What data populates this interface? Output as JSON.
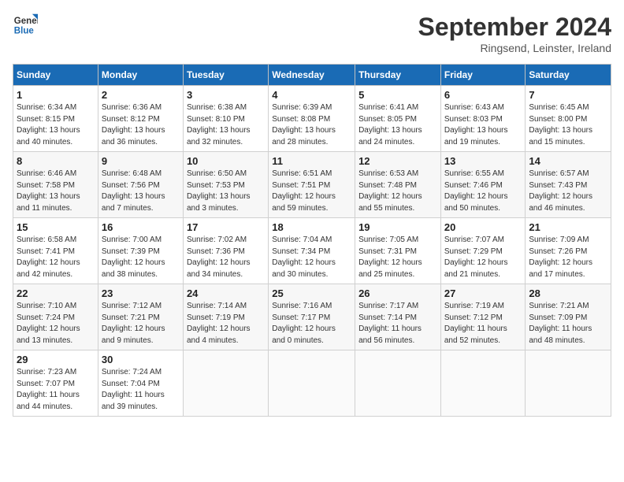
{
  "header": {
    "logo_line1": "General",
    "logo_line2": "Blue",
    "month": "September 2024",
    "location": "Ringsend, Leinster, Ireland"
  },
  "columns": [
    "Sunday",
    "Monday",
    "Tuesday",
    "Wednesday",
    "Thursday",
    "Friday",
    "Saturday"
  ],
  "weeks": [
    [
      {
        "day": "1",
        "lines": [
          "Sunrise: 6:34 AM",
          "Sunset: 8:15 PM",
          "Daylight: 13 hours",
          "and 40 minutes."
        ]
      },
      {
        "day": "2",
        "lines": [
          "Sunrise: 6:36 AM",
          "Sunset: 8:12 PM",
          "Daylight: 13 hours",
          "and 36 minutes."
        ]
      },
      {
        "day": "3",
        "lines": [
          "Sunrise: 6:38 AM",
          "Sunset: 8:10 PM",
          "Daylight: 13 hours",
          "and 32 minutes."
        ]
      },
      {
        "day": "4",
        "lines": [
          "Sunrise: 6:39 AM",
          "Sunset: 8:08 PM",
          "Daylight: 13 hours",
          "and 28 minutes."
        ]
      },
      {
        "day": "5",
        "lines": [
          "Sunrise: 6:41 AM",
          "Sunset: 8:05 PM",
          "Daylight: 13 hours",
          "and 24 minutes."
        ]
      },
      {
        "day": "6",
        "lines": [
          "Sunrise: 6:43 AM",
          "Sunset: 8:03 PM",
          "Daylight: 13 hours",
          "and 19 minutes."
        ]
      },
      {
        "day": "7",
        "lines": [
          "Sunrise: 6:45 AM",
          "Sunset: 8:00 PM",
          "Daylight: 13 hours",
          "and 15 minutes."
        ]
      }
    ],
    [
      {
        "day": "8",
        "lines": [
          "Sunrise: 6:46 AM",
          "Sunset: 7:58 PM",
          "Daylight: 13 hours",
          "and 11 minutes."
        ]
      },
      {
        "day": "9",
        "lines": [
          "Sunrise: 6:48 AM",
          "Sunset: 7:56 PM",
          "Daylight: 13 hours",
          "and 7 minutes."
        ]
      },
      {
        "day": "10",
        "lines": [
          "Sunrise: 6:50 AM",
          "Sunset: 7:53 PM",
          "Daylight: 13 hours",
          "and 3 minutes."
        ]
      },
      {
        "day": "11",
        "lines": [
          "Sunrise: 6:51 AM",
          "Sunset: 7:51 PM",
          "Daylight: 12 hours",
          "and 59 minutes."
        ]
      },
      {
        "day": "12",
        "lines": [
          "Sunrise: 6:53 AM",
          "Sunset: 7:48 PM",
          "Daylight: 12 hours",
          "and 55 minutes."
        ]
      },
      {
        "day": "13",
        "lines": [
          "Sunrise: 6:55 AM",
          "Sunset: 7:46 PM",
          "Daylight: 12 hours",
          "and 50 minutes."
        ]
      },
      {
        "day": "14",
        "lines": [
          "Sunrise: 6:57 AM",
          "Sunset: 7:43 PM",
          "Daylight: 12 hours",
          "and 46 minutes."
        ]
      }
    ],
    [
      {
        "day": "15",
        "lines": [
          "Sunrise: 6:58 AM",
          "Sunset: 7:41 PM",
          "Daylight: 12 hours",
          "and 42 minutes."
        ]
      },
      {
        "day": "16",
        "lines": [
          "Sunrise: 7:00 AM",
          "Sunset: 7:39 PM",
          "Daylight: 12 hours",
          "and 38 minutes."
        ]
      },
      {
        "day": "17",
        "lines": [
          "Sunrise: 7:02 AM",
          "Sunset: 7:36 PM",
          "Daylight: 12 hours",
          "and 34 minutes."
        ]
      },
      {
        "day": "18",
        "lines": [
          "Sunrise: 7:04 AM",
          "Sunset: 7:34 PM",
          "Daylight: 12 hours",
          "and 30 minutes."
        ]
      },
      {
        "day": "19",
        "lines": [
          "Sunrise: 7:05 AM",
          "Sunset: 7:31 PM",
          "Daylight: 12 hours",
          "and 25 minutes."
        ]
      },
      {
        "day": "20",
        "lines": [
          "Sunrise: 7:07 AM",
          "Sunset: 7:29 PM",
          "Daylight: 12 hours",
          "and 21 minutes."
        ]
      },
      {
        "day": "21",
        "lines": [
          "Sunrise: 7:09 AM",
          "Sunset: 7:26 PM",
          "Daylight: 12 hours",
          "and 17 minutes."
        ]
      }
    ],
    [
      {
        "day": "22",
        "lines": [
          "Sunrise: 7:10 AM",
          "Sunset: 7:24 PM",
          "Daylight: 12 hours",
          "and 13 minutes."
        ]
      },
      {
        "day": "23",
        "lines": [
          "Sunrise: 7:12 AM",
          "Sunset: 7:21 PM",
          "Daylight: 12 hours",
          "and 9 minutes."
        ]
      },
      {
        "day": "24",
        "lines": [
          "Sunrise: 7:14 AM",
          "Sunset: 7:19 PM",
          "Daylight: 12 hours",
          "and 4 minutes."
        ]
      },
      {
        "day": "25",
        "lines": [
          "Sunrise: 7:16 AM",
          "Sunset: 7:17 PM",
          "Daylight: 12 hours",
          "and 0 minutes."
        ]
      },
      {
        "day": "26",
        "lines": [
          "Sunrise: 7:17 AM",
          "Sunset: 7:14 PM",
          "Daylight: 11 hours",
          "and 56 minutes."
        ]
      },
      {
        "day": "27",
        "lines": [
          "Sunrise: 7:19 AM",
          "Sunset: 7:12 PM",
          "Daylight: 11 hours",
          "and 52 minutes."
        ]
      },
      {
        "day": "28",
        "lines": [
          "Sunrise: 7:21 AM",
          "Sunset: 7:09 PM",
          "Daylight: 11 hours",
          "and 48 minutes."
        ]
      }
    ],
    [
      {
        "day": "29",
        "lines": [
          "Sunrise: 7:23 AM",
          "Sunset: 7:07 PM",
          "Daylight: 11 hours",
          "and 44 minutes."
        ]
      },
      {
        "day": "30",
        "lines": [
          "Sunrise: 7:24 AM",
          "Sunset: 7:04 PM",
          "Daylight: 11 hours",
          "and 39 minutes."
        ]
      },
      {
        "day": "",
        "lines": []
      },
      {
        "day": "",
        "lines": []
      },
      {
        "day": "",
        "lines": []
      },
      {
        "day": "",
        "lines": []
      },
      {
        "day": "",
        "lines": []
      }
    ]
  ]
}
